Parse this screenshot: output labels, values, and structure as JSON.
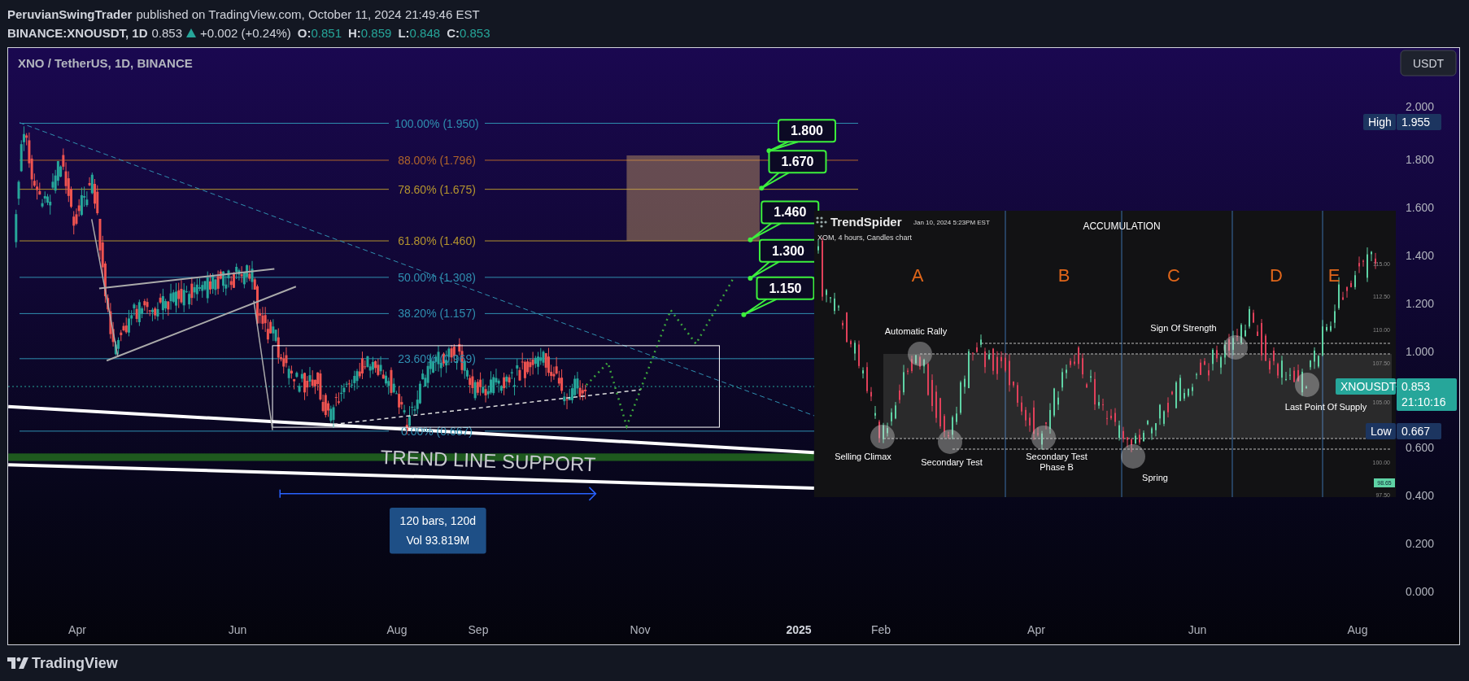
{
  "header": {
    "author": "PeruvianSwingTrader",
    "published": "published on TradingView.com, October 11, 2024 21:49:46 EST",
    "symbol": "BINANCE:XNOUSDT, 1D",
    "last": "0.853",
    "change": "+0.002 (+0.24%)",
    "ohlc": [
      {
        "label": "O:",
        "value": "0.851"
      },
      {
        "label": "H:",
        "value": "0.859"
      },
      {
        "label": "L:",
        "value": "0.848"
      },
      {
        "label": "C:",
        "value": "0.853"
      }
    ]
  },
  "chart": {
    "title": "XNO / TetherUS, 1D, BINANCE",
    "currency_button": "USDT",
    "price_ticks": [
      "2.000",
      "1.800",
      "1.600",
      "1.400",
      "1.200",
      "1.000",
      "0.600",
      "0.400",
      "0.200",
      "0.000"
    ],
    "high_badge": {
      "label": "High",
      "value": "1.955"
    },
    "low_badge": {
      "label": "Low",
      "value": "0.667"
    },
    "last_badge": {
      "symbol": "XNOUSDT",
      "value": "0.853",
      "countdown": "21:10:16"
    },
    "time_ticks": [
      {
        "label": "Apr",
        "kind": "month"
      },
      {
        "label": "Jun",
        "kind": "month"
      },
      {
        "label": "Aug",
        "kind": "month"
      },
      {
        "label": "Sep",
        "kind": "month"
      },
      {
        "label": "Nov",
        "kind": "month"
      },
      {
        "label": "2025",
        "kind": "year"
      },
      {
        "label": "Feb",
        "kind": "month"
      },
      {
        "label": "Apr",
        "kind": "month"
      },
      {
        "label": "Jun",
        "kind": "month"
      },
      {
        "label": "Aug",
        "kind": "month"
      }
    ],
    "fib_levels": [
      {
        "label": "100.00% (1.950)",
        "color": "#2f8fb0"
      },
      {
        "label": "88.00% (1.796)",
        "color": "#b0652a"
      },
      {
        "label": "78.60% (1.675)",
        "color": "#b5952e"
      },
      {
        "label": "61.80% (1.460)",
        "color": "#b5952e"
      },
      {
        "label": "50.00% (1.308)",
        "color": "#2f8fb0"
      },
      {
        "label": "38.20% (1.157)",
        "color": "#2f8fb0"
      },
      {
        "label": "23.60% (0.969)",
        "color": "#2f8fb0"
      },
      {
        "label": "0.00% (0.667)",
        "color": "#2f8fb0"
      }
    ],
    "targets": [
      "1.800",
      "1.670",
      "1.460",
      "1.300",
      "1.150"
    ],
    "annotation": "TREND LINE SUPPORT",
    "measure": {
      "lines": [
        "120 bars, 120d",
        "Vol 93.819M"
      ]
    },
    "inset": {
      "brand": "TrendSpider",
      "date": "Jan 10, 2024 5:23PM EST",
      "subtitle": "XOM, 4 hours, Candles chart",
      "heading": "ACCUMULATION",
      "phases": [
        "A",
        "B",
        "C",
        "D",
        "E"
      ],
      "events": [
        {
          "lines": [
            "Automatic Rally"
          ]
        },
        {
          "lines": [
            "Sign Of Strength"
          ]
        },
        {
          "lines": [
            "Selling Climax"
          ]
        },
        {
          "lines": [
            "Secondary Test"
          ]
        },
        {
          "lines": [
            "Secondary Test",
            "Phase B"
          ]
        },
        {
          "lines": [
            "Spring"
          ]
        },
        {
          "lines": [
            "Last Point Of Supply"
          ]
        }
      ],
      "price_ticks": [
        "115.00",
        "112.50",
        "110.00",
        "107.50",
        "105.00",
        "100.00",
        "97.50"
      ],
      "price_badge": "98.65"
    }
  },
  "footer": {
    "logo": "TradingView"
  }
}
